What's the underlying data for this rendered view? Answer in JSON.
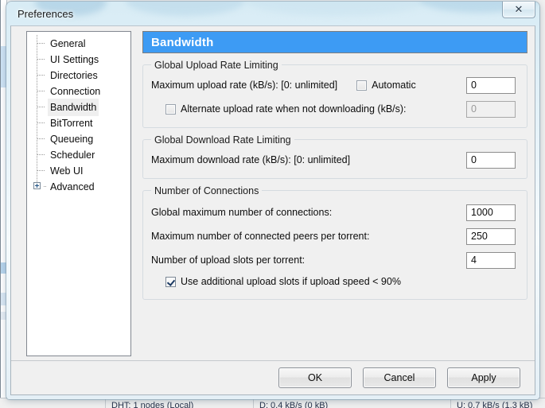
{
  "window": {
    "title": "Preferences",
    "close_label": "✕"
  },
  "sidebar": {
    "items": [
      {
        "label": "General",
        "selected": false,
        "expandable": false
      },
      {
        "label": "UI Settings",
        "selected": false,
        "expandable": false
      },
      {
        "label": "Directories",
        "selected": false,
        "expandable": false
      },
      {
        "label": "Connection",
        "selected": false,
        "expandable": false
      },
      {
        "label": "Bandwidth",
        "selected": true,
        "expandable": false
      },
      {
        "label": "BitTorrent",
        "selected": false,
        "expandable": false
      },
      {
        "label": "Queueing",
        "selected": false,
        "expandable": false
      },
      {
        "label": "Scheduler",
        "selected": false,
        "expandable": false
      },
      {
        "label": "Web UI",
        "selected": false,
        "expandable": false
      },
      {
        "label": "Advanced",
        "selected": false,
        "expandable": true
      }
    ]
  },
  "page": {
    "title": "Bandwidth",
    "accent_color": "#3d9bf4",
    "groups": {
      "upload": {
        "legend": "Global Upload Rate Limiting",
        "max_upload_label": "Maximum upload rate (kB/s): [0: unlimited]",
        "automatic_label": "Automatic",
        "automatic_checked": false,
        "max_upload_value": "0",
        "alternate_label": "Alternate upload rate when not downloading (kB/s):",
        "alternate_checked": false,
        "alternate_value": "0",
        "alternate_disabled": true
      },
      "download": {
        "legend": "Global Download Rate Limiting",
        "max_download_label": "Maximum download rate (kB/s): [0: unlimited]",
        "max_download_value": "0"
      },
      "connections": {
        "legend": "Number of Connections",
        "global_max_label": "Global maximum number of connections:",
        "global_max_value": "1000",
        "max_peers_label": "Maximum number of connected peers per torrent:",
        "max_peers_value": "250",
        "upload_slots_label": "Number of upload slots per torrent:",
        "upload_slots_value": "4",
        "additional_slots_label": "Use additional upload slots if upload speed < 90%",
        "additional_slots_checked": true
      }
    }
  },
  "footer": {
    "ok_label": "OK",
    "cancel_label": "Cancel",
    "apply_label": "Apply"
  },
  "background_status": {
    "dht": "DHT: 1 nodes (Local)",
    "download_speed": "D: 0.4 kB/s (0 kB)",
    "upload_speed": "U: 0.7 kB/s (1.3 kB)"
  }
}
